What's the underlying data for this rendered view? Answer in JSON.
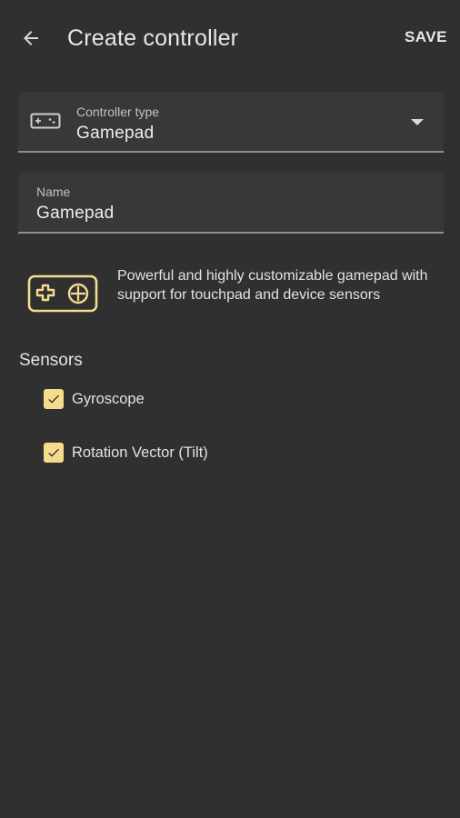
{
  "toolbar": {
    "title": "Create controller",
    "save_label": "SAVE",
    "back_icon": "arrow-back-icon"
  },
  "controller_type": {
    "label": "Controller type",
    "value": "Gamepad",
    "icon": "gamepad-icon",
    "dropdown_icon": "dropdown-arrow-icon"
  },
  "name_field": {
    "label": "Name",
    "value": "Gamepad"
  },
  "description": {
    "icon": "gamepad-large-icon",
    "text": "Powerful and highly customizable gamepad with support for touchpad and device sensors"
  },
  "sensors": {
    "title": "Sensors",
    "items": [
      {
        "label": "Gyroscope",
        "checked": true
      },
      {
        "label": "Rotation Vector (Tilt)",
        "checked": true
      }
    ]
  },
  "colors": {
    "background": "#303030",
    "field_background": "#383838",
    "accent": "#f5dc8c"
  }
}
